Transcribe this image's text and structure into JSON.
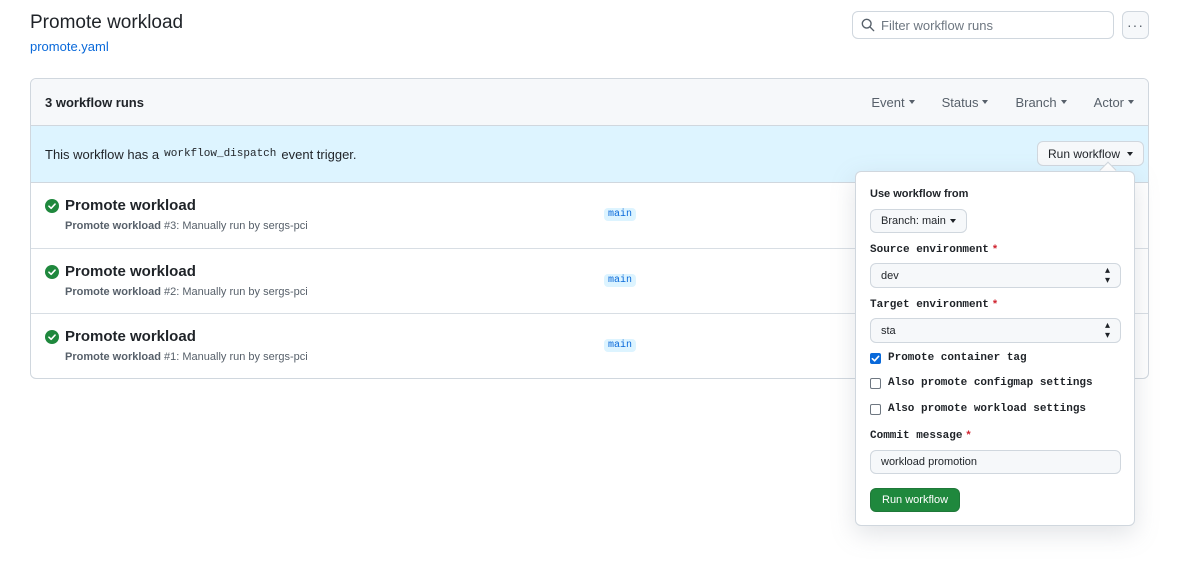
{
  "header": {
    "title": "Promote workload",
    "file_link": "promote.yaml",
    "search_placeholder": "Filter workflow runs",
    "more_icon": "kebab-horizontal-icon",
    "more_label": "···"
  },
  "runs_box": {
    "count_label": "3 workflow runs",
    "filters": [
      "Event",
      "Status",
      "Branch",
      "Actor"
    ],
    "dispatch": {
      "prefix": "This workflow has a",
      "code": "workflow_dispatch",
      "suffix": "event trigger.",
      "button_label": "Run workflow"
    },
    "runs": [
      {
        "title": "Promote workload",
        "workflow": "Promote workload",
        "detail": "#3: Manually run by sergs-pci",
        "branch": "main",
        "status_icon": "check-circle-fill-icon"
      },
      {
        "title": "Promote workload",
        "workflow": "Promote workload",
        "detail": "#2: Manually run by sergs-pci",
        "branch": "main",
        "status_icon": "check-circle-fill-icon"
      },
      {
        "title": "Promote workload",
        "workflow": "Promote workload",
        "detail": "#1: Manually run by sergs-pci",
        "branch": "main",
        "status_icon": "check-circle-fill-icon"
      }
    ]
  },
  "popover": {
    "use_from_label": "Use workflow from",
    "branch_button": "Branch: main",
    "source_label": "Source environment",
    "source_value": "dev",
    "target_label": "Target environment",
    "target_value": "sta",
    "required_mark": "*",
    "checkboxes": [
      {
        "label": "Promote container tag",
        "checked": true
      },
      {
        "label": "Also promote configmap settings",
        "checked": false
      },
      {
        "label": "Also promote workload settings",
        "checked": false
      }
    ],
    "commit_label": "Commit message",
    "commit_value": "workload promotion",
    "submit_label": "Run workflow"
  },
  "colors": {
    "success": "#1f883d",
    "link": "#0969da",
    "info_bg": "#ddf4ff",
    "required": "#cf222e"
  }
}
